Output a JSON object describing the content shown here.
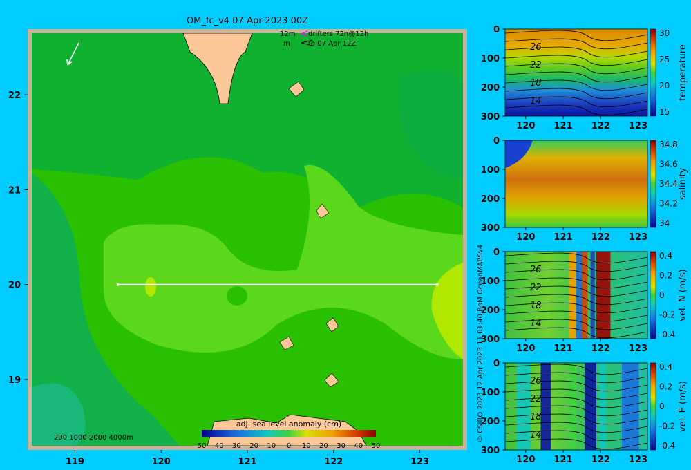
{
  "title": "OM_fc_v4  07-Apr-2023 00Z",
  "legend": {
    "scale_label": "12m",
    "drifters_label": "drifters 72h@12h",
    "m_label": "m",
    "to_label": "to 07 Apr 12Z"
  },
  "depth_legend": "200  1000  2000  4000m",
  "credit": "© CSIRO 2023   12 Apr 2023 11:01:40 BoM OceanMAPSv4",
  "colors": {
    "background": "#00ccff",
    "land": "#fcc898",
    "coast_border": "#c8b49a",
    "section_line": "#ffffff"
  },
  "chart_data": [
    {
      "type": "heatmap",
      "name": "map",
      "xticks": [
        119,
        120,
        121,
        122,
        123
      ],
      "yticks": [
        19,
        20,
        21,
        22
      ],
      "xlim": [
        118.5,
        123.5
      ],
      "ylim": [
        18.3,
        22.65
      ],
      "colorbar": {
        "label": "adj. sea level anomaly (cm)",
        "ticks": [
          "50",
          "40",
          "30",
          "20",
          "10",
          "0",
          "10",
          "20",
          "30",
          "40",
          "50"
        ]
      },
      "section_line": {
        "lon": [
          119.5,
          123.2
        ],
        "lat": [
          20,
          20
        ]
      }
    },
    {
      "type": "heatmap",
      "name": "temperature",
      "xticks": [
        "120",
        "121",
        "122",
        "123"
      ],
      "yticks": [
        "0",
        "100",
        "200",
        "300"
      ],
      "cbar_ticks": [
        "30",
        "25",
        "20",
        "15"
      ],
      "cbar_label": "temperature",
      "contour_labels": [
        "26",
        "22",
        "18",
        "14"
      ]
    },
    {
      "type": "heatmap",
      "name": "salinity",
      "xticks": [
        "120",
        "121",
        "122",
        "123"
      ],
      "yticks": [
        "0",
        "100",
        "200",
        "300"
      ],
      "cbar_ticks": [
        "34.8",
        "34.6",
        "34.4",
        "34.2",
        "34"
      ],
      "cbar_label": "salinity"
    },
    {
      "type": "heatmap",
      "name": "vel_n",
      "xticks": [
        "120",
        "121",
        "122",
        "123"
      ],
      "yticks": [
        "0",
        "100",
        "200",
        "300"
      ],
      "cbar_ticks": [
        "0.4",
        "0.2",
        "0",
        "-0.2",
        "-0.4"
      ],
      "cbar_label": "vel. N (m/s)",
      "contour_labels": [
        "26",
        "22",
        "18",
        "14"
      ]
    },
    {
      "type": "heatmap",
      "name": "vel_e",
      "xticks": [
        "120",
        "121",
        "122",
        "123"
      ],
      "yticks": [
        "0",
        "100",
        "200",
        "300"
      ],
      "cbar_ticks": [
        "0.4",
        "0.2",
        "0",
        "-0.2",
        "-0.4"
      ],
      "cbar_label": "vel. E (m/s)",
      "contour_labels": [
        "26",
        "22",
        "18",
        "14"
      ]
    }
  ]
}
